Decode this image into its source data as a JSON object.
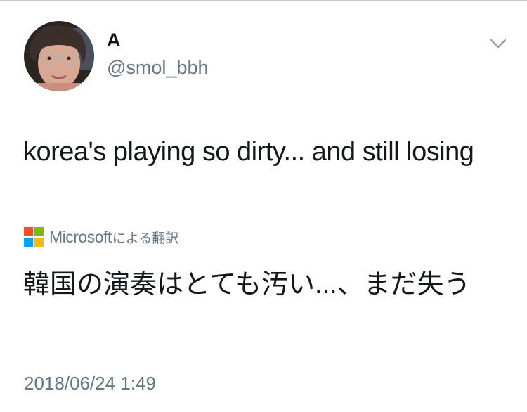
{
  "tweet": {
    "display_name": "A",
    "handle": "@smol_bbh",
    "text": "korea's playing so dirty... and still losing",
    "translation": {
      "brand": "Microsoft",
      "suffix": "による翻訳",
      "logo_colors": [
        "#f25022",
        "#7fba00",
        "#00a4ef",
        "#ffb900"
      ],
      "text": "韓国の演奏はとても汚い...、まだ失う"
    },
    "timestamp": "2018/06/24 1:49",
    "menu_icon": "chevron-down-icon"
  },
  "colors": {
    "text_primary": "#14171a",
    "text_secondary": "#657786",
    "divider": "#c9cdd1"
  }
}
